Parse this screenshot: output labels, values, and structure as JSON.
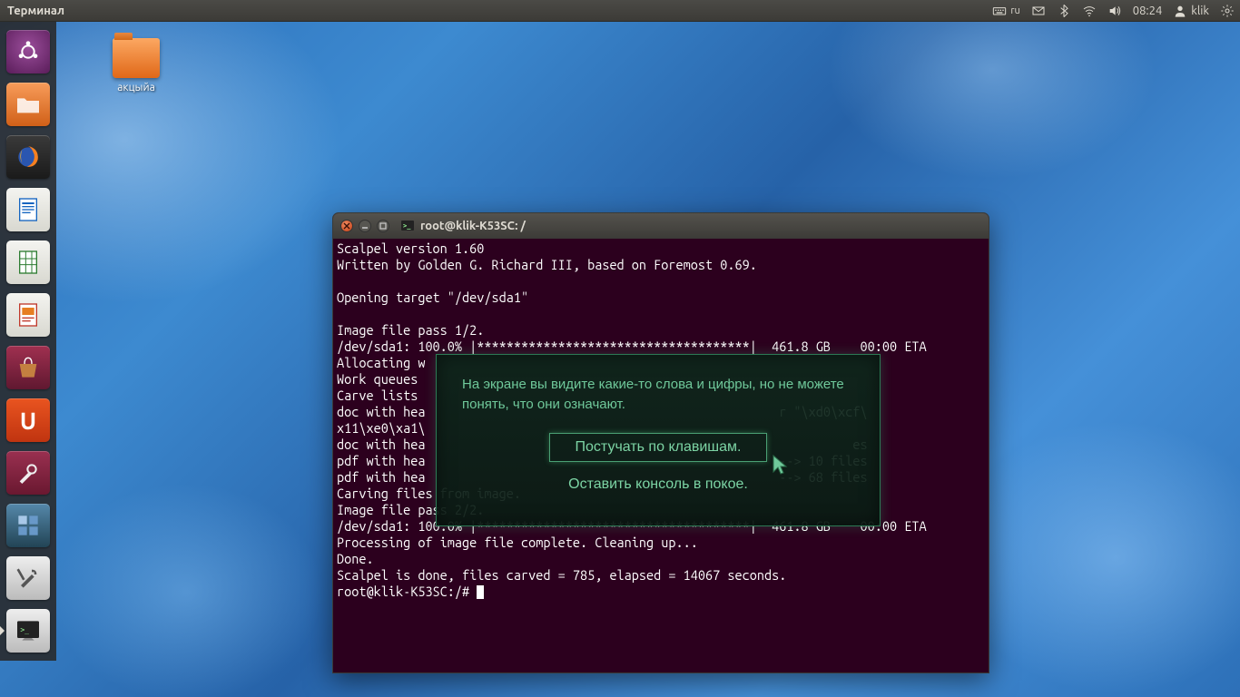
{
  "menubar": {
    "title": "Терминал",
    "kbd_lang": "ru",
    "time": "08:24",
    "user": "klik"
  },
  "desktop": {
    "folder_name": "акцыйа"
  },
  "terminal": {
    "title": "root@klik-K53SC: /",
    "lines": [
      "Scalpel version 1.60",
      "Written by Golden G. Richard III, based on Foremost 0.69.",
      "",
      "Opening target \"/dev/sda1\"",
      "",
      "Image file pass 1/2.",
      "/dev/sda1: 100.0% |*************************************|  461.8 GB    00:00 ETA",
      "Allocating w",
      "Work queues ",
      "Carve lists ",
      "doc with hea                                                          r \"\\xd0\\xcf\\x11\\xe0\\xa1\\",
      "doc with hea                                                          es",
      "pdf with hea                                                          --> 10 files",
      "pdf with hea                                                          --> 68 files",
      "Carving files from image.",
      "Image file pass 2/2.",
      "/dev/sda1: 100.0% |*************************************|  461.8 GB    00:00 ETA",
      "Processing of image file complete. Cleaning up...",
      "Done.",
      "Scalpel is done, files carved = 785, elapsed = 14067 seconds."
    ],
    "prompt": "root@klik-K53SC:/# "
  },
  "overlay": {
    "message": "На экране вы видите какие-то слова и цифры, но не можете понять, что они означают.",
    "option1": "Постучать по клавишам.",
    "option2": "Оставить консоль в покое."
  },
  "launcher": {
    "items": [
      {
        "name": "dash"
      },
      {
        "name": "files"
      },
      {
        "name": "firefox"
      },
      {
        "name": "writer"
      },
      {
        "name": "calc"
      },
      {
        "name": "impress"
      },
      {
        "name": "software-center"
      },
      {
        "name": "ubuntu-one"
      },
      {
        "name": "settings"
      },
      {
        "name": "workspace"
      },
      {
        "name": "system-settings"
      },
      {
        "name": "terminal"
      }
    ]
  }
}
